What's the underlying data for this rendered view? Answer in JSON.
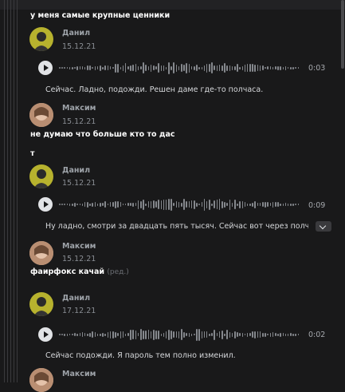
{
  "messages": [
    {
      "text": "у меня самые крупные ценники"
    },
    {
      "sender": "Данил",
      "date": "15.12.21",
      "duration": "0:03",
      "transcript": "Сейчас. Ладно, подожди. Решен даме где-то полчаса."
    },
    {
      "sender": "Максим",
      "date": "15.12.21"
    },
    {
      "text": "не думаю что больше кто то дас"
    },
    {
      "text": "т"
    },
    {
      "sender": "Данил",
      "date": "15.12.21",
      "duration": "0:09",
      "transcript": "Ну ладно, смотри за двадцать пять тысяч. Сейчас вот через полчаса"
    },
    {
      "sender": "Максим",
      "date": "15.12.21"
    },
    {
      "text": "фаирфокс качай",
      "edited": "(ред.)"
    },
    {
      "sender": "Данил",
      "date": "17.12.21",
      "duration": "0:02",
      "transcript": "Сейчас подожди. Я пароль тем полно изменил."
    },
    {
      "sender": "Максим"
    }
  ],
  "colors": {
    "background": "#19191a",
    "text": "#e1e3e6",
    "muted": "#8a8e94",
    "accent_avatar_danil": "#b7b22e"
  },
  "icons": {
    "play": "play-icon",
    "expand": "chevron-down-icon"
  }
}
